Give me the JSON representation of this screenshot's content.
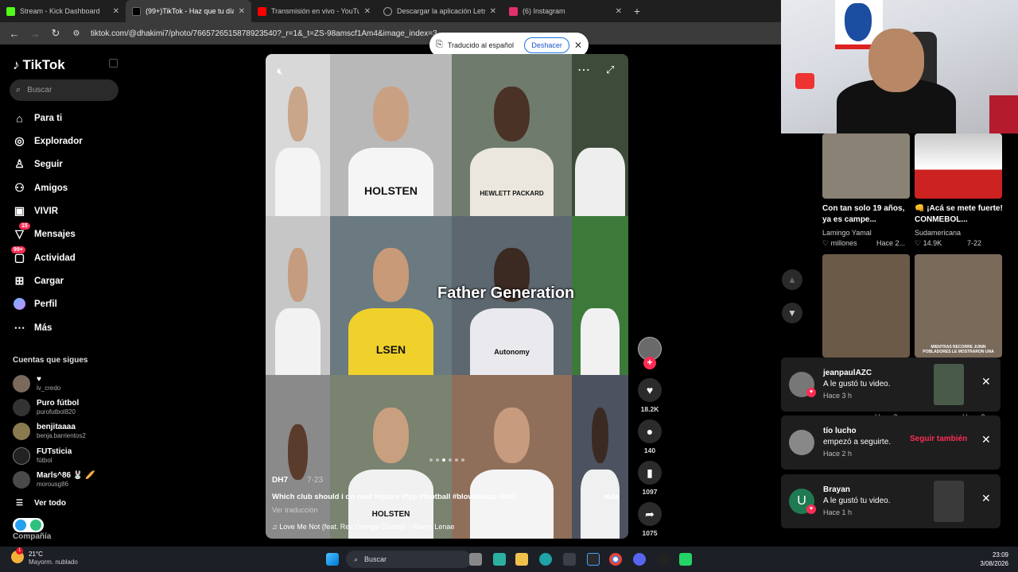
{
  "browser": {
    "tabs": [
      {
        "title": "Stream - Kick Dashboard",
        "color": "#53fc18",
        "active": false
      },
      {
        "title": "(99+)TikTok - Haz que tu día se",
        "color": "#ffffff",
        "active": true
      },
      {
        "title": "Transmisión en vivo - YouTube",
        "color": "#ff0000",
        "active": false
      },
      {
        "title": "Descargar la aplicación LetsVie",
        "color": "#9aa0a6",
        "active": false
      },
      {
        "title": "(6) Instagram",
        "color": "#e1306c",
        "active": false
      }
    ],
    "url": "tiktok.com/@dhakimi7/photo/7665726515878923540?_r=1&_t=ZS-98amscf1Am4&image_index=3",
    "new_tab": "+"
  },
  "translate_popup": {
    "text": "Traducido al español",
    "undo_label": "Deshacer"
  },
  "sidebar": {
    "logo": "TikTok",
    "search_placeholder": "Buscar",
    "items": [
      {
        "label": "Para ti",
        "icon": "home-icon",
        "badge": ""
      },
      {
        "label": "Explorador",
        "icon": "compass-icon",
        "badge": ""
      },
      {
        "label": "Seguir",
        "icon": "user-follow-icon",
        "badge": ""
      },
      {
        "label": "Amigos",
        "icon": "friends-icon",
        "badge": ""
      },
      {
        "label": "VIVIR",
        "icon": "live-icon",
        "badge": ""
      },
      {
        "label": "Mensajes",
        "icon": "messages-icon",
        "badge": "15"
      },
      {
        "label": "Actividad",
        "icon": "activity-icon",
        "badge": "99+"
      },
      {
        "label": "Cargar",
        "icon": "upload-icon",
        "badge": ""
      },
      {
        "label": "Perfil",
        "icon": "profile-icon",
        "badge": ""
      },
      {
        "label": "Más",
        "icon": "more-icon",
        "badge": ""
      }
    ],
    "following_header": "Cuentas que sigues",
    "following": [
      {
        "name": "♥",
        "handle": "lv_credo"
      },
      {
        "name": "Puro fútbol",
        "handle": "purofutbol820"
      },
      {
        "name": "benjitaaaa",
        "handle": "benja.barrientos2"
      },
      {
        "name": "FUTsticia",
        "handle": "fútbol"
      },
      {
        "name": "Marls^86 🐰 🥖",
        "handle": "morousg86"
      }
    ],
    "see_all": "Ver todo",
    "company": "Compañía"
  },
  "video": {
    "overlay_title": "Father Generation",
    "author": "DH7",
    "date": "7-23",
    "caption": "Which club should i do next #spurs #fyp #football #blowthisup #dh7",
    "more": "más",
    "translate": "Ver traducción",
    "music": "Love Me Not (feat. Rex Orange County) - Ravyn Lenae",
    "slogans": [
      "HOLSTEN",
      "HEWLETT PACKARD",
      "LSEN",
      "Autonomy",
      "HOLSTEN"
    ],
    "image_dots": 6,
    "current_dot": 3
  },
  "actions": {
    "likes": "18.2K",
    "comments": "140",
    "saves": "1097",
    "shares": "1075"
  },
  "right_panel": {
    "videos": [
      {
        "title": "Con tan solo 19 años, ya es campe...",
        "author": "Lamingo Yamal",
        "likes": "millones",
        "time": "Hace 2..."
      },
      {
        "title": "👊 ¡Acá se mete fuerte! CONMEBOL...",
        "author": "Sudamericana",
        "likes": "14.9K",
        "time": "7-22"
      }
    ],
    "row2_meta": [
      "Hace 2...",
      "Hace 3..."
    ],
    "thumb_caption": "MIENTRAS RECORRE JUNIN POBLADORES LE MOSTRARON UNA"
  },
  "notifications": [
    {
      "name": "jeanpaulAZC",
      "text": "A le gustó tu video.",
      "time": "Hace 3 h",
      "action": ""
    },
    {
      "name": "tío lucho",
      "text": "empezó a seguirte.",
      "time": "Hace 2 h",
      "action": "Seguir también"
    },
    {
      "name": "Brayan",
      "text": "A le gustó tu video.",
      "time": "Hace 1 h",
      "action": ""
    }
  ],
  "taskbar": {
    "temp": "21°C",
    "weather": "Mayorm. nublado",
    "search_placeholder": "Buscar",
    "time": "23:09",
    "date": "3/08/2026"
  }
}
